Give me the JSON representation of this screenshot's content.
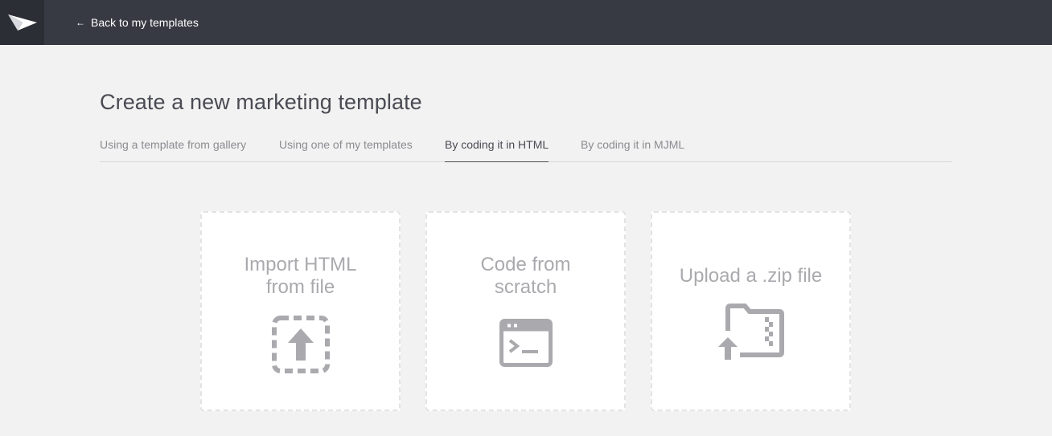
{
  "header": {
    "back_label": "Back to my templates",
    "back_icon": "arrow-left",
    "logo_icon": "paper-plane",
    "background": "#383a43"
  },
  "main": {
    "title": "Create a new marketing template",
    "tabs": [
      {
        "label": "Using a template from gallery",
        "active": false
      },
      {
        "label": "Using one of my templates",
        "active": false
      },
      {
        "label": "By coding it in HTML",
        "active": true
      },
      {
        "label": "By coding it in MJML",
        "active": false
      }
    ],
    "options": [
      {
        "title": "Import HTML\nfrom file",
        "icon": "upload-icon"
      },
      {
        "title": "Code from\nscratch",
        "icon": "terminal-window-icon"
      },
      {
        "title": "Upload a .zip file",
        "icon": "zip-folder-upload-icon"
      }
    ]
  },
  "colors": {
    "page_bg": "#f2f2f2",
    "card_bg": "#ffffff",
    "icon_gray": "#aaaaae"
  }
}
